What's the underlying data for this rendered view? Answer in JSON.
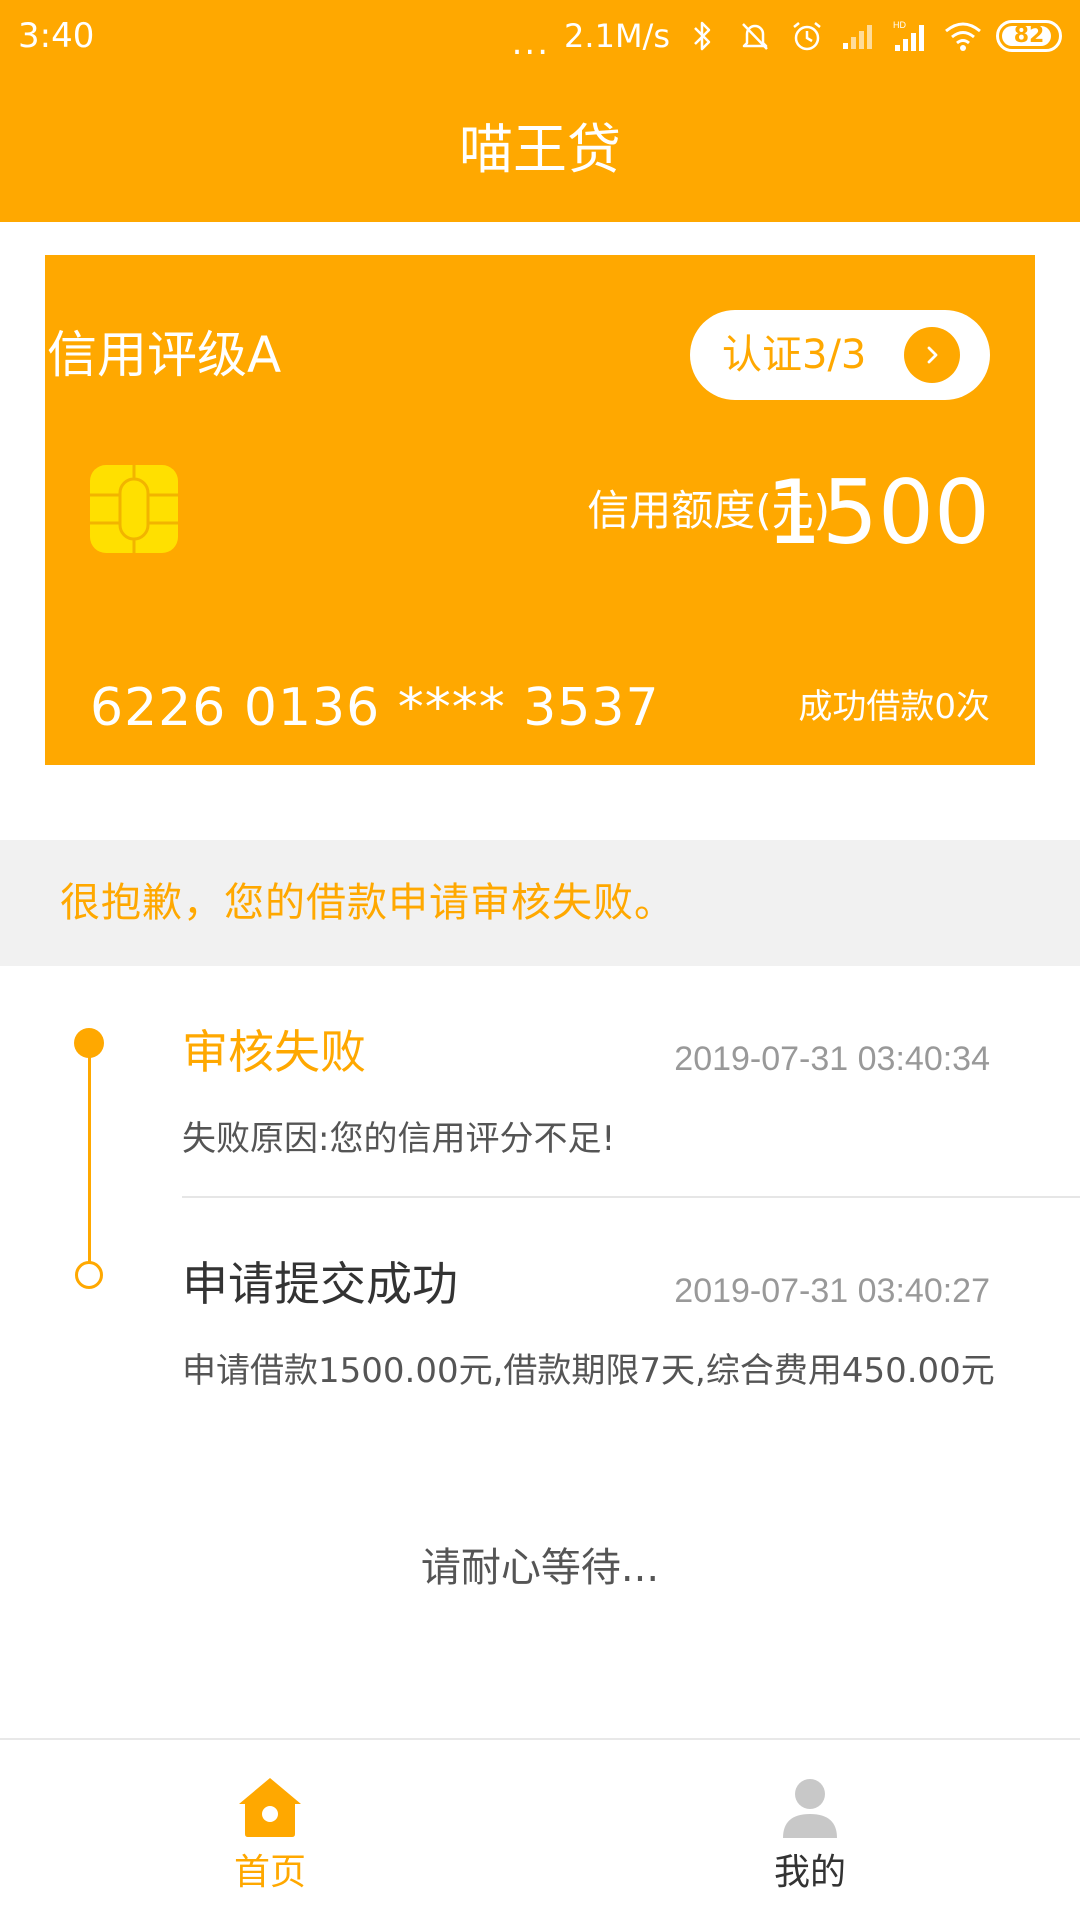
{
  "status_bar": {
    "time": "3:40",
    "dots": "...",
    "net_speed": "2.1M/s",
    "battery_level": "82",
    "icons": [
      "bluetooth-icon",
      "mute-icon",
      "alarm-icon",
      "signal-icon",
      "signal-hd-icon",
      "wifi-icon",
      "battery-icon"
    ]
  },
  "header": {
    "title": "喵王贷"
  },
  "card": {
    "rating": "信用评级A",
    "certification_label": "认证3/3",
    "credit_limit_label": "信用额度(元)",
    "credit_limit_value": "1500",
    "card_number": "6226 0136 **** 3537",
    "success_count": "成功借款0次"
  },
  "notice": {
    "text": "很抱歉，您的借款申请审核失败。"
  },
  "timeline": [
    {
      "title": "审核失败",
      "time": "2019-07-31 03:40:34",
      "description": "失败原因:您的信用评分不足!"
    },
    {
      "title": "申请提交成功",
      "time": "2019-07-31 03:40:27",
      "description": "申请借款1500.00元,借款期限7天,综合费用450.00元"
    }
  ],
  "wait_message": "请耐心等待...",
  "bottom_nav": {
    "home_label": "首页",
    "mine_label": "我的"
  },
  "colors": {
    "accent": "#FFA800",
    "chip": "#FFE000",
    "notice_bg": "#F1F1F1",
    "nav_inactive": "#C8C8C8"
  }
}
